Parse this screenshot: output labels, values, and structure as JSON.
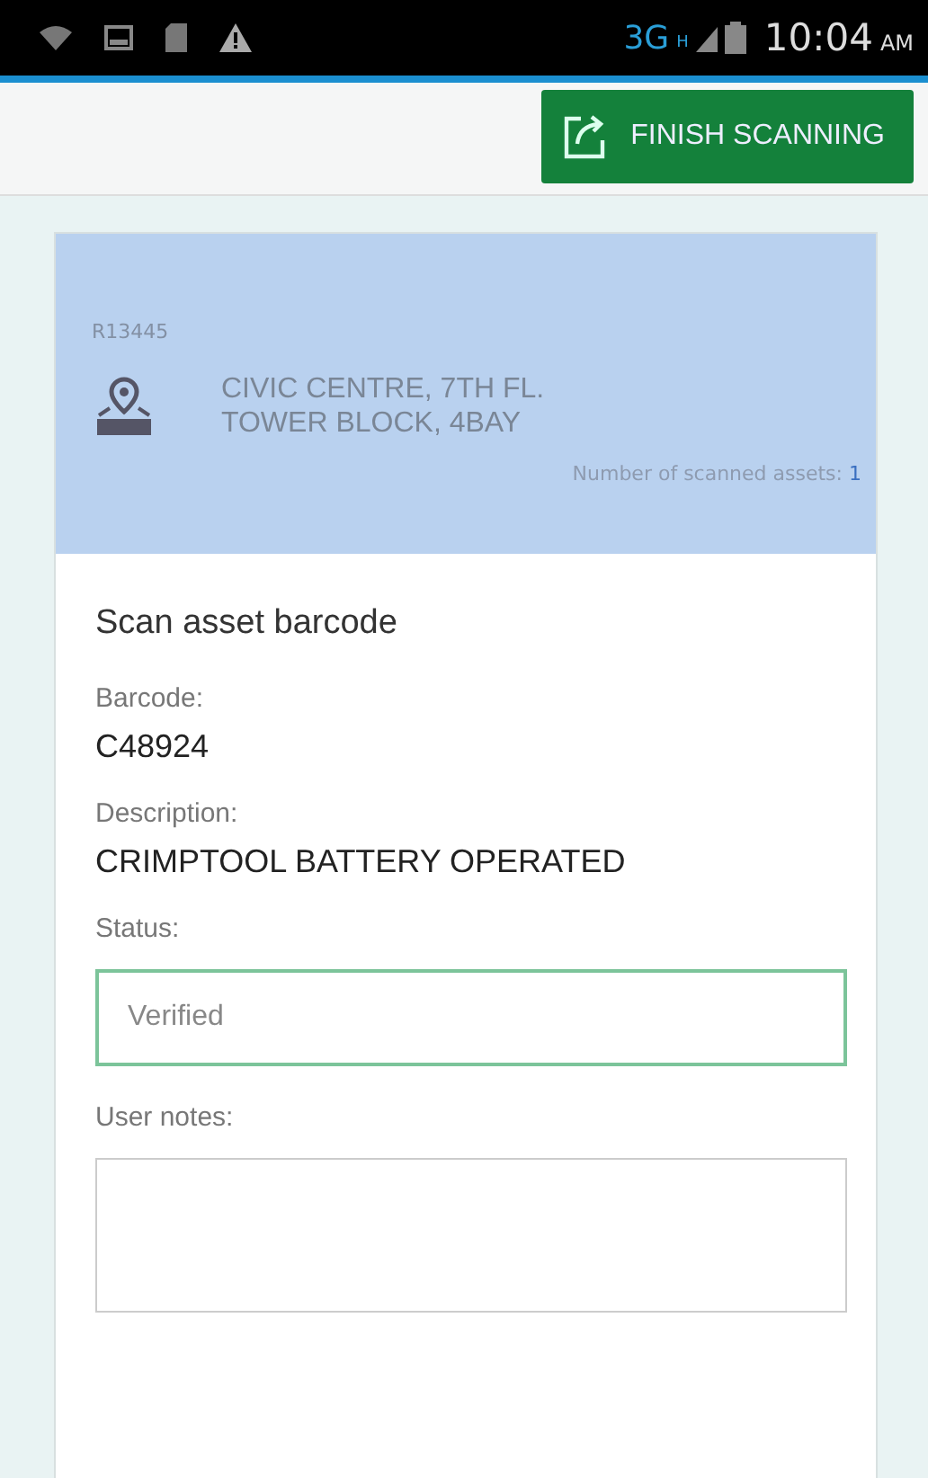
{
  "status_bar": {
    "network": "3G",
    "network_sub": "H",
    "time": "10:04",
    "ampm": "AM"
  },
  "header": {
    "button": "FINISH SCANNING"
  },
  "location": {
    "code": "R13445",
    "name": "CIVIC CENTRE, 7TH FL.\nTOWER BLOCK, 4BAY",
    "count_label": "Number of scanned assets:",
    "count": "1"
  },
  "form": {
    "title": "Scan asset barcode",
    "fields": [
      {
        "kind": "text",
        "label": "Barcode:",
        "value": "C48924"
      },
      {
        "kind": "text",
        "label": "Description:",
        "value": "CRIMPTOOL BATTERY OPERATED"
      },
      {
        "kind": "input",
        "label": "Status:",
        "value": "Verified",
        "focused": true
      },
      {
        "kind": "input",
        "label": "User notes:",
        "focused": false
      }
    ]
  }
}
